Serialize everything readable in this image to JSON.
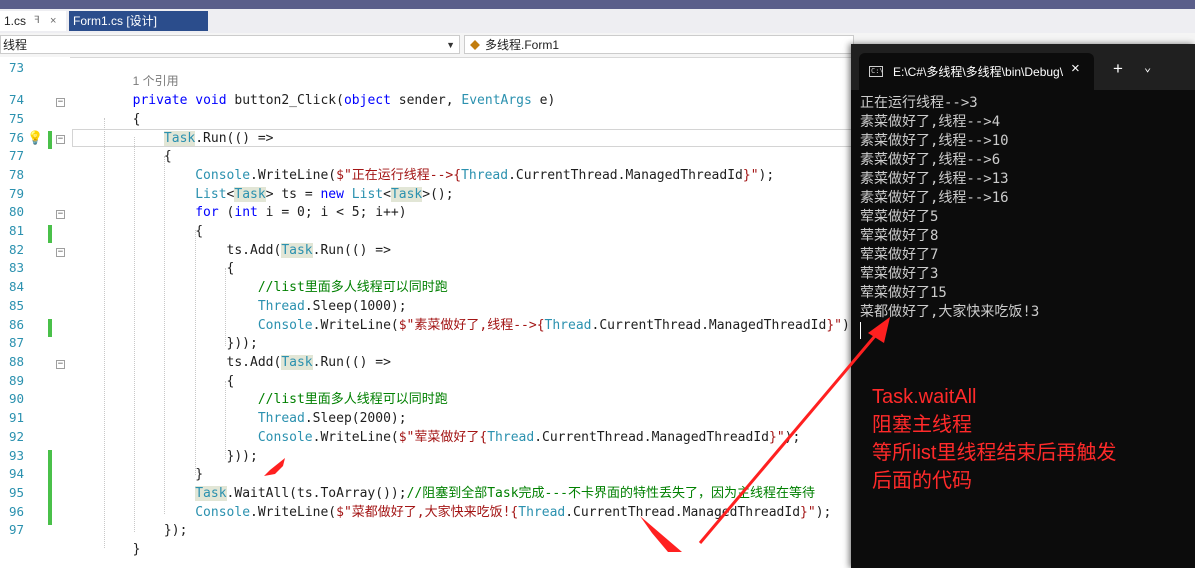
{
  "tabs": [
    {
      "label": "1.cs",
      "active": true,
      "pin": "ꟻ",
      "close": "×"
    },
    {
      "label": "Form1.cs [设计]",
      "active": false
    }
  ],
  "nav": {
    "left": "线程",
    "middle": "多线程.Form1",
    "right": "button2_Click(object sender, EventArgs e)"
  },
  "editor": {
    "line_numbers": [
      "73",
      "74",
      "75",
      "76",
      "77",
      "78",
      "79",
      "80",
      "81",
      "82",
      "83",
      "84",
      "85",
      "86",
      "87",
      "88",
      "89",
      "90",
      "91",
      "92",
      "93",
      "94",
      "95",
      "96",
      "97"
    ],
    "reference_hint": "1 个引用"
  },
  "console": {
    "title": "E:\\C#\\多线程\\多线程\\bin\\Debug\\多线程.exe",
    "close": "×",
    "plus": "+",
    "chevron": "⌄",
    "lines": [
      "正在运行线程-->3",
      "素菜做好了,线程-->4",
      "素菜做好了,线程-->10",
      "素菜做好了,线程-->6",
      "素菜做好了,线程-->13",
      "素菜做好了,线程-->16",
      "荤菜做好了5",
      "荤菜做好了8",
      "荤菜做好了7",
      "荤菜做好了3",
      "荤菜做好了15",
      "菜都做好了,大家快来吃饭!3"
    ]
  },
  "annotation": "Task.waitAll\n阻塞主线程\n等所list里线程结束后再触发\n后面的代码",
  "colors": {
    "keyword": "#0000ff",
    "type": "#2b91af",
    "comment": "#008000",
    "string": "#a31515",
    "annotation": "#ff2a2a",
    "console_bg": "#0c0c0c"
  }
}
